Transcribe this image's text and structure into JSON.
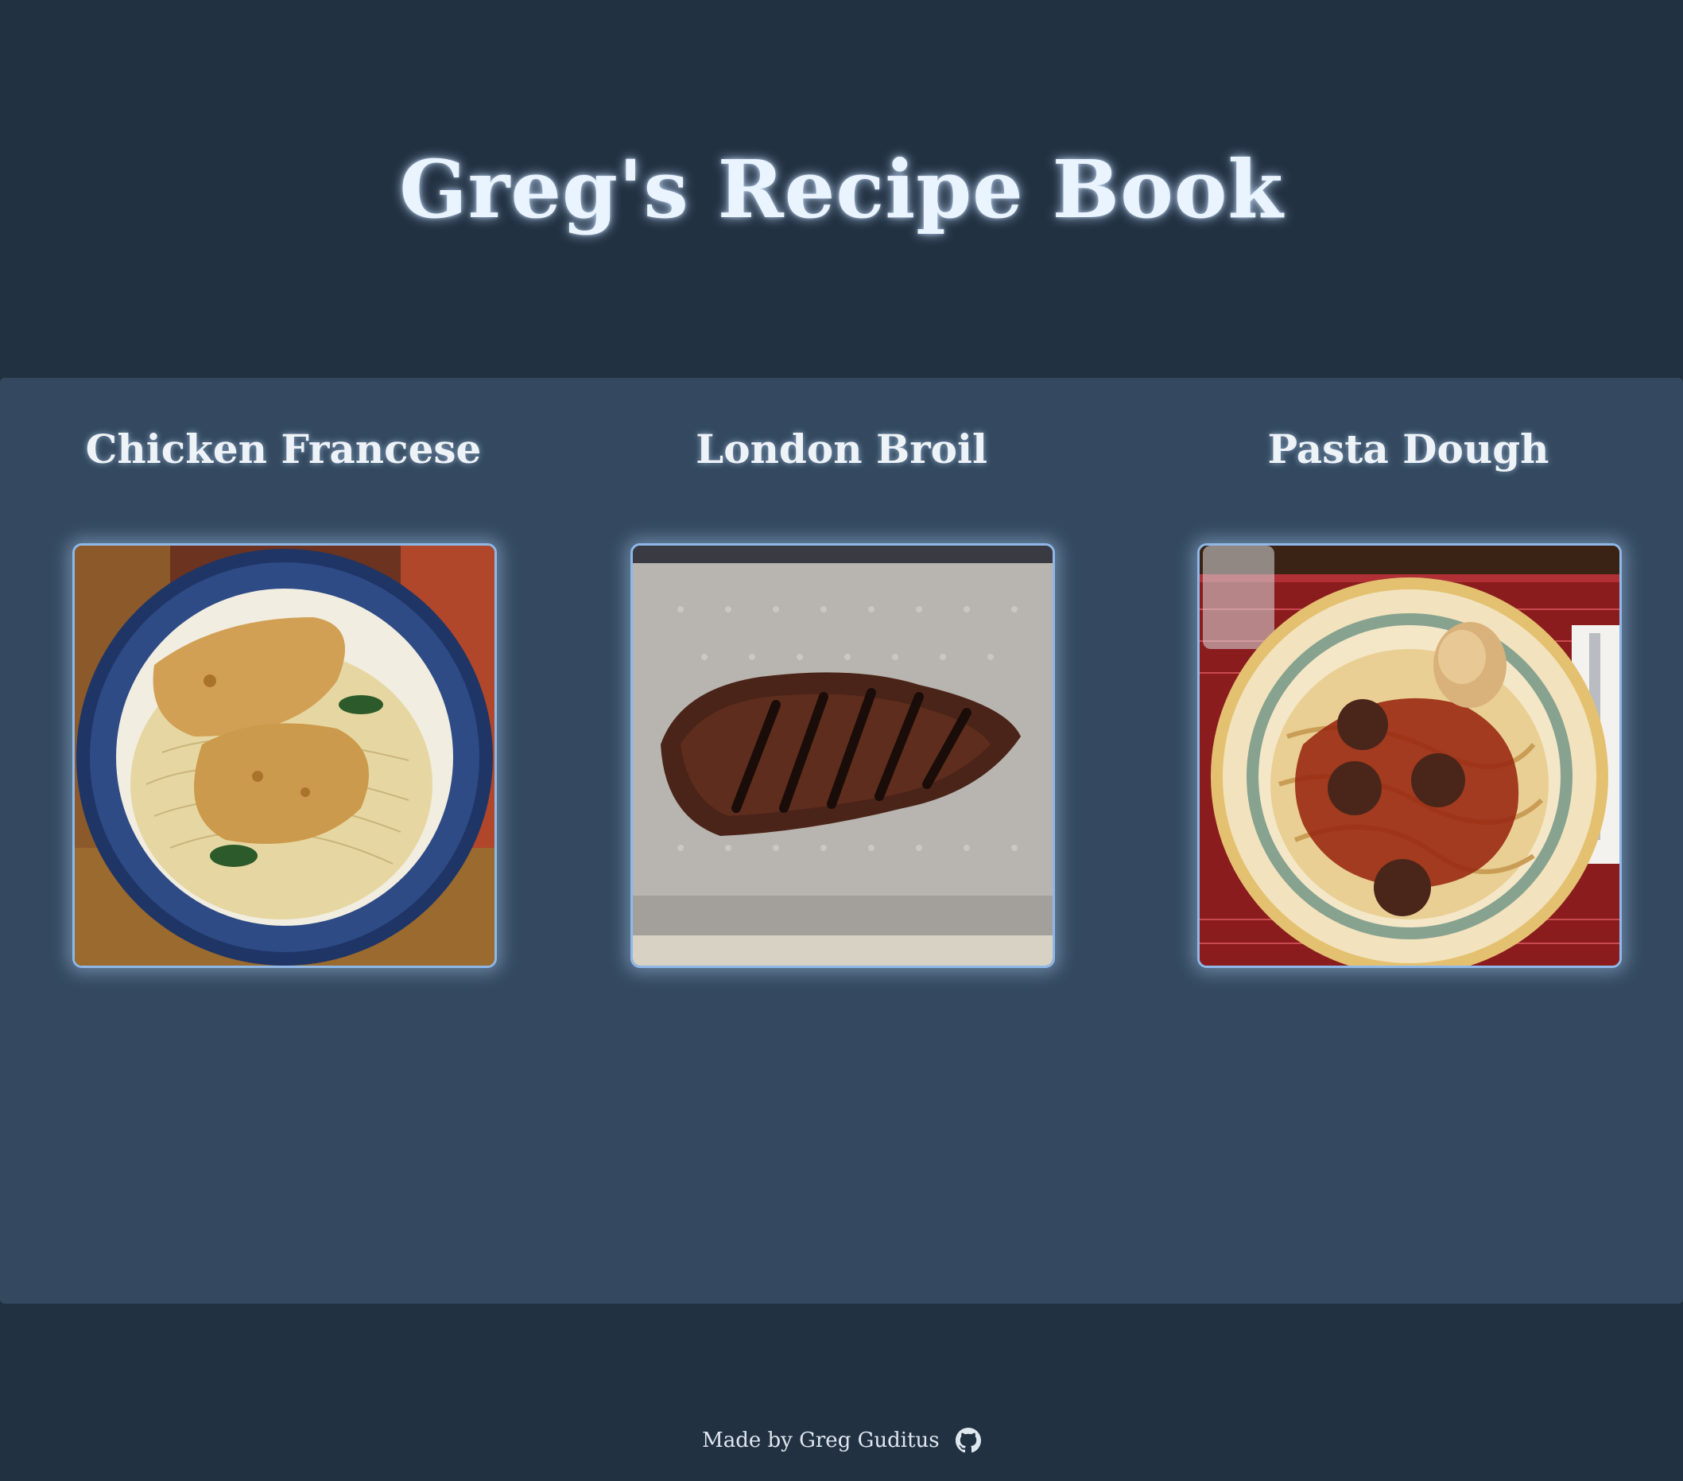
{
  "header": {
    "title": "Greg's Recipe Book"
  },
  "recipes": [
    {
      "name": "Chicken Francese",
      "image_icon": "chicken-francese-photo"
    },
    {
      "name": "London Broil",
      "image_icon": "london-broil-photo"
    },
    {
      "name": "Pasta Dough",
      "image_icon": "pasta-dough-photo"
    }
  ],
  "footer": {
    "credit": "Made by Greg Guditus",
    "link_icon": "github-icon"
  },
  "colors": {
    "background": "#223142",
    "panel": "#34495f",
    "title_text": "#eaf4ff",
    "card_border": "#8fb8e8"
  }
}
